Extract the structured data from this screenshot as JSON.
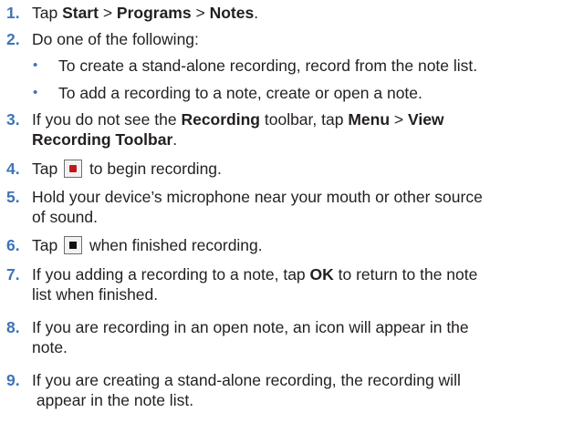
{
  "steps": [
    {
      "num": "1.",
      "parts": [
        "Tap ",
        "Start",
        " > ",
        "Programs",
        " > ",
        "Notes",
        "."
      ]
    },
    {
      "num": "2.",
      "text": "Do one of the following:"
    },
    {
      "num": "3.",
      "line1": [
        "If you do not see the ",
        "Recording",
        " toolbar, tap ",
        "Menu",
        " > ",
        "View"
      ],
      "line2": [
        "Recording Toolbar",
        "."
      ]
    },
    {
      "num": "4.",
      "pre": "Tap ",
      "post": " to begin recording.",
      "icon": "record-icon"
    },
    {
      "num": "5.",
      "line1": "Hold your device’s microphone near your mouth or other source",
      "line2": "of sound."
    },
    {
      "num": "6.",
      "pre": "Tap ",
      "post": " when finished recording.",
      "icon": "stop-icon"
    },
    {
      "num": "7.",
      "line1": [
        "If you adding a recording to a note, tap ",
        "OK",
        " to return to the note"
      ],
      "line2": "list when finished."
    },
    {
      "num": "8.",
      "line1": "If you are recording in an open note, an icon will appear in the",
      "line2": "note."
    },
    {
      "num": "9.",
      "line1": "If you are creating a stand-alone recording, the recording will",
      "line2": " appear in the note list."
    }
  ],
  "sub_items": [
    {
      "bullet": "•",
      "text": "To create a stand-alone recording, record from the note list."
    },
    {
      "bullet": "•",
      "text": "To add a recording to a note, create or open a note."
    }
  ],
  "colors": {
    "number": "#3e74b9",
    "text": "#231f20",
    "record_icon": "#c3161c"
  }
}
